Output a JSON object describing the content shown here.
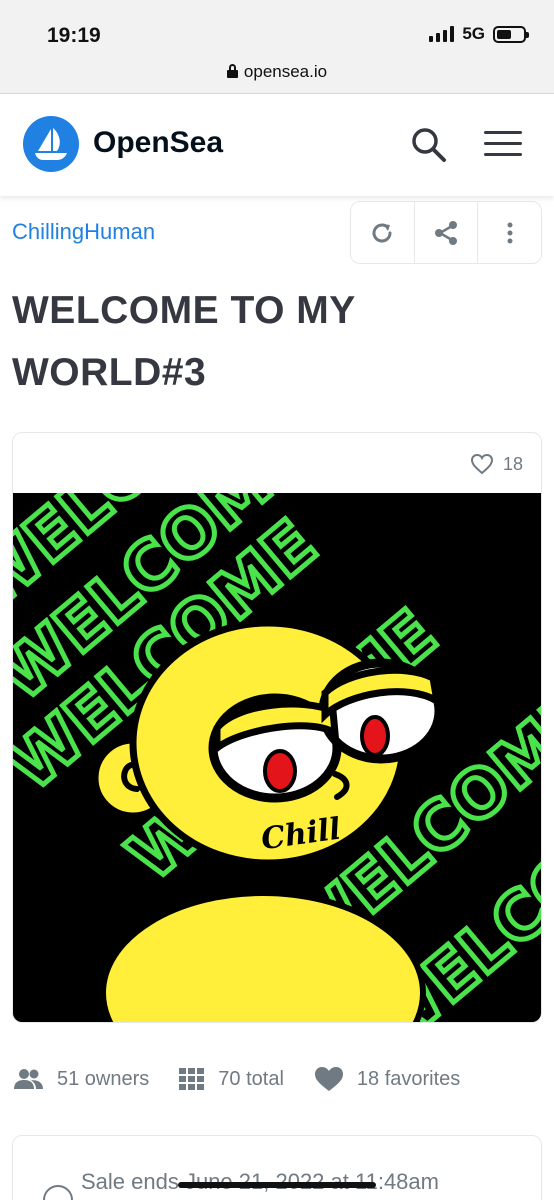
{
  "status_bar": {
    "time": "19:19",
    "network": "5G"
  },
  "browser": {
    "url": "opensea.io"
  },
  "header": {
    "brand": "OpenSea",
    "logo_icon": "opensea-boat-icon",
    "search_icon": "search-icon",
    "menu_icon": "hamburger-menu-icon"
  },
  "asset": {
    "collection": "ChillingHuman",
    "title": "WELCOME TO MY WORLD#3",
    "favorites_count": "18",
    "artwork_lettering": "WELCOME",
    "artwork_signature": "Chill"
  },
  "actions": {
    "refresh_icon": "refresh-icon",
    "share_icon": "share-icon",
    "more_icon": "more-vertical-icon"
  },
  "stats": {
    "owners": "51 owners",
    "total": "70 total",
    "favorites": "18 favorites"
  },
  "sale": {
    "text": "Sale ends June 21, 2022 at 11:48am"
  },
  "colors": {
    "accent": "#2081e2",
    "text": "#353840",
    "muted": "#707a83",
    "art_green": "#4be34b",
    "art_yellow": "#ffef3a"
  }
}
